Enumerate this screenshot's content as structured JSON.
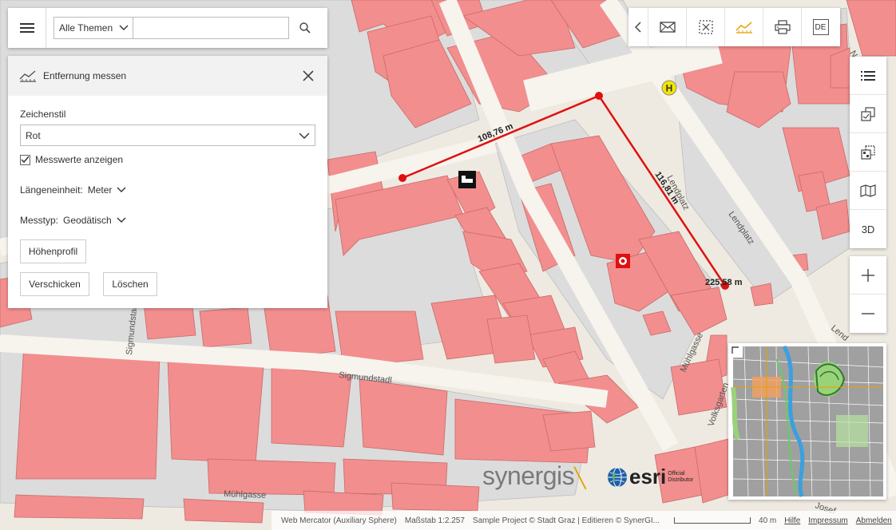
{
  "search": {
    "theme_label": "Alle Themen",
    "placeholder": ""
  },
  "measure_panel": {
    "title": "Entfernung messen",
    "style_label": "Zeichenstil",
    "style_value": "Rot",
    "show_values_label": "Messwerte anzeigen",
    "show_values_checked": true,
    "unit_label": "Längeneinheit:",
    "unit_value": "Meter",
    "type_label": "Messtyp:",
    "type_value": "Geodätisch",
    "profile_button": "Höhenprofil",
    "send_button": "Verschicken",
    "delete_button": "Löschen"
  },
  "toolbar": {
    "lang": "DE",
    "icons": [
      "chevron-left-icon",
      "mail-icon",
      "select-area-icon",
      "measure-icon",
      "print-icon",
      "language-icon"
    ],
    "active_color": "#e8a000"
  },
  "side_tools": {
    "three_d": "3D"
  },
  "map": {
    "streets": [
      "Sigmundstadl",
      "Sigmundstadl",
      "Mühlgasse",
      "Mühlgasse",
      "Lendplatz",
      "Lendplatz",
      "Volksgarten",
      "Lend",
      "Josef",
      "N"
    ],
    "measurements": [
      "108,76 m",
      "116,81 m",
      "225,58 m"
    ],
    "building_color": "#f28e8e",
    "measure_color": "#e01010",
    "bus_stop": "H"
  },
  "logos": {
    "synergis": "synergis",
    "esri": "esri",
    "esri_sub": "Official\nDistributor"
  },
  "attribution": {
    "projection": "Web Mercator (Auxiliary Sphere)",
    "scale": "Maßstab 1:2.257",
    "copyright": "Sample Project © Stadt Graz | Editieren © SynerGI...",
    "scalebar_label": "40 m",
    "help": "Hilfe",
    "imprint": "Impressum",
    "logout": "Abmelden"
  }
}
